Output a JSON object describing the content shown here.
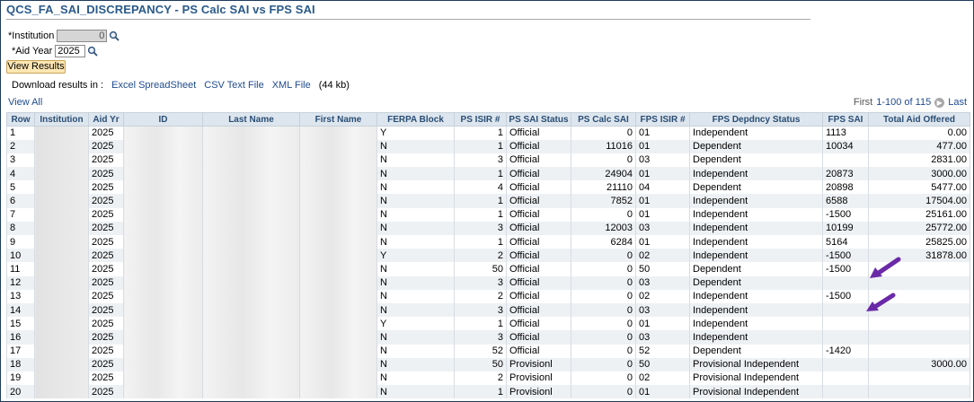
{
  "page": {
    "title": "QCS_FA_SAI_DISCREPANCY - PS Calc SAI vs FPS SAI"
  },
  "form": {
    "institution_label": "*Institution",
    "institution_value": "0",
    "aid_year_label": "*Aid Year",
    "aid_year_value": "2025",
    "view_results_label": "View Results"
  },
  "download": {
    "label": "Download results in :",
    "excel": "Excel SpreadSheet",
    "csv": "CSV Text File",
    "xml": "XML File",
    "size": "(44 kb)"
  },
  "grid": {
    "view_all": "View All",
    "pager_first": "First",
    "pager_range": "1-100 of 115",
    "pager_last": "Last",
    "columns": [
      "Row",
      "Institution",
      "Aid Yr",
      "ID",
      "Last Name",
      "First Name",
      "FERPA Block",
      "PS ISIR #",
      "PS SAI Status",
      "PS Calc SAI",
      "FPS ISIR #",
      "FPS Depdncy Status",
      "FPS SAI",
      "Total Aid Offered"
    ],
    "rows": [
      [
        "1",
        "",
        "2025",
        "",
        "",
        "",
        "Y",
        "1",
        "Official",
        "0",
        "01",
        "Independent",
        "1113",
        "0.00"
      ],
      [
        "2",
        "",
        "2025",
        "",
        "",
        "",
        "N",
        "1",
        "Official",
        "11016",
        "01",
        "Dependent",
        "10034",
        "477.00"
      ],
      [
        "3",
        "",
        "2025",
        "",
        "",
        "",
        "N",
        "3",
        "Official",
        "0",
        "03",
        "Dependent",
        "",
        "2831.00"
      ],
      [
        "4",
        "",
        "2025",
        "",
        "",
        "",
        "N",
        "1",
        "Official",
        "24904",
        "01",
        "Independent",
        "20873",
        "3000.00"
      ],
      [
        "5",
        "",
        "2025",
        "",
        "",
        "",
        "N",
        "4",
        "Official",
        "21110",
        "04",
        "Dependent",
        "20898",
        "5477.00"
      ],
      [
        "6",
        "",
        "2025",
        "",
        "",
        "",
        "N",
        "1",
        "Official",
        "7852",
        "01",
        "Independent",
        "6588",
        "17504.00"
      ],
      [
        "7",
        "",
        "2025",
        "",
        "",
        "",
        "N",
        "1",
        "Official",
        "0",
        "01",
        "Independent",
        "-1500",
        "25161.00"
      ],
      [
        "8",
        "",
        "2025",
        "",
        "",
        "",
        "N",
        "3",
        "Official",
        "12003",
        "03",
        "Independent",
        "10199",
        "25772.00"
      ],
      [
        "9",
        "",
        "2025",
        "",
        "",
        "",
        "N",
        "1",
        "Official",
        "6284",
        "01",
        "Independent",
        "5164",
        "25825.00"
      ],
      [
        "10",
        "",
        "2025",
        "",
        "",
        "",
        "Y",
        "2",
        "Official",
        "0",
        "02",
        "Independent",
        "-1500",
        "31878.00"
      ],
      [
        "11",
        "",
        "2025",
        "",
        "",
        "",
        "N",
        "50",
        "Official",
        "0",
        "50",
        "Dependent",
        "-1500",
        ""
      ],
      [
        "12",
        "",
        "2025",
        "",
        "",
        "",
        "N",
        "3",
        "Official",
        "0",
        "03",
        "Dependent",
        "",
        ""
      ],
      [
        "13",
        "",
        "2025",
        "",
        "",
        "",
        "N",
        "2",
        "Official",
        "0",
        "02",
        "Independent",
        "-1500",
        ""
      ],
      [
        "14",
        "",
        "2025",
        "",
        "",
        "",
        "N",
        "3",
        "Official",
        "0",
        "03",
        "Independent",
        "",
        ""
      ],
      [
        "15",
        "",
        "2025",
        "",
        "",
        "",
        "Y",
        "1",
        "Official",
        "0",
        "01",
        "Independent",
        "",
        ""
      ],
      [
        "16",
        "",
        "2025",
        "",
        "",
        "",
        "N",
        "3",
        "Official",
        "0",
        "03",
        "Independent",
        "",
        ""
      ],
      [
        "17",
        "",
        "2025",
        "",
        "",
        "",
        "N",
        "52",
        "Official",
        "0",
        "52",
        "Dependent",
        "-1420",
        ""
      ],
      [
        "18",
        "",
        "2025",
        "",
        "",
        "",
        "N",
        "50",
        "Provisionl",
        "0",
        "50",
        "Provisional  Independent",
        "",
        "3000.00"
      ],
      [
        "19",
        "",
        "2025",
        "",
        "",
        "",
        "N",
        "2",
        "Provisionl",
        "0",
        "02",
        "Provisional  Independent",
        "",
        ""
      ],
      [
        "20",
        "",
        "2025",
        "",
        "",
        "",
        "N",
        "1",
        "Provisionl",
        "0",
        "01",
        "Provisional  Independent",
        "",
        ""
      ]
    ]
  },
  "annotation": {
    "arrow_color": "#6a2aa8"
  },
  "icons": {
    "lookup": "magnifier-icon",
    "next": "chevron-right-icon",
    "annotation": "arrow-icon"
  }
}
